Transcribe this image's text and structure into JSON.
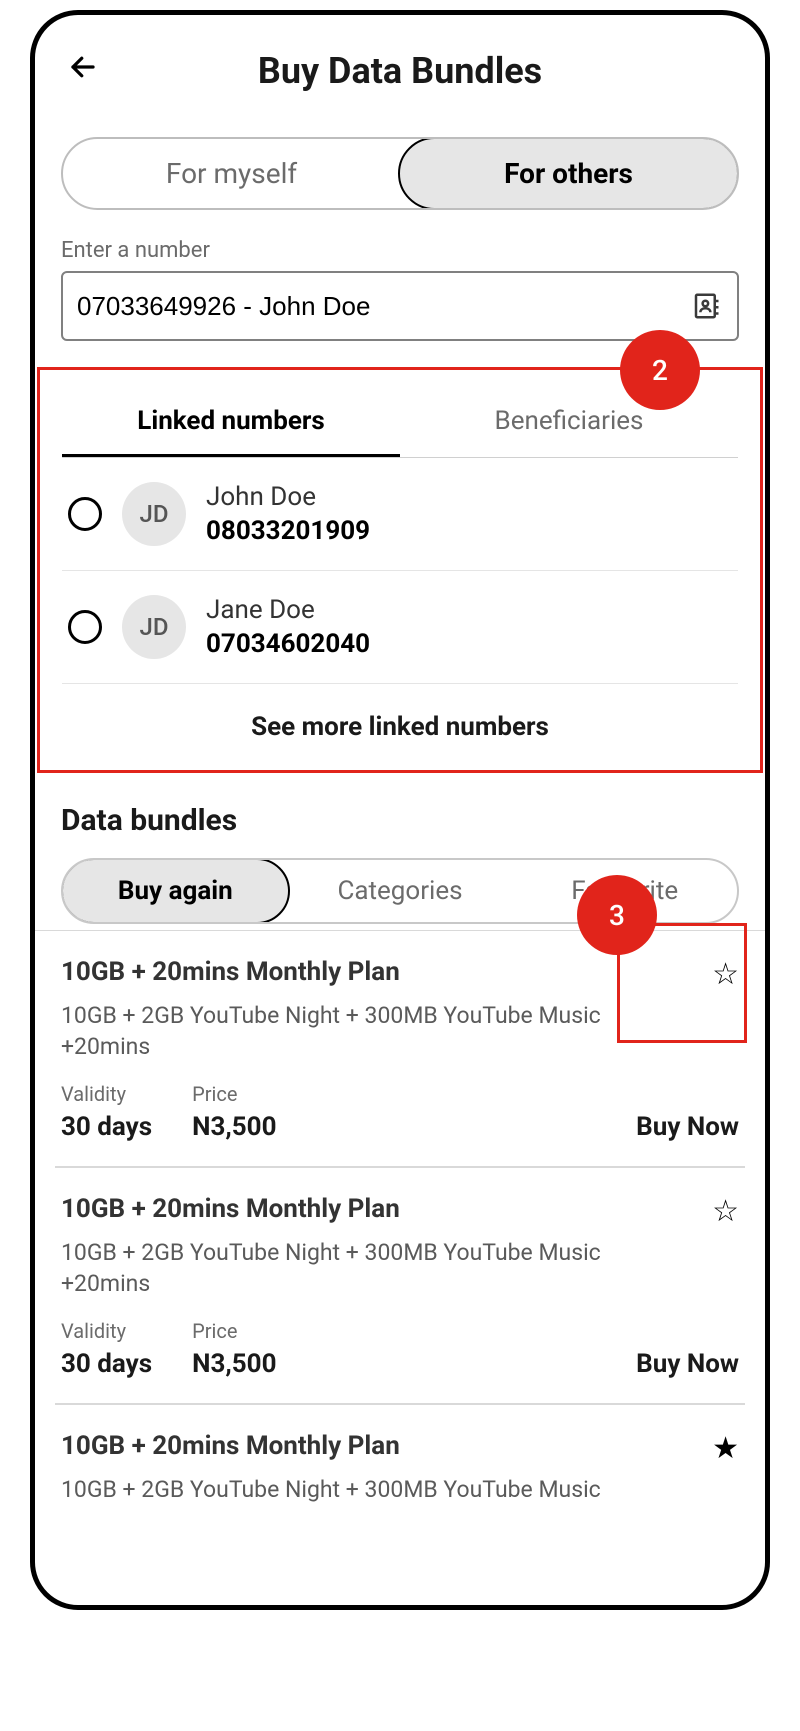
{
  "header": {
    "title": "Buy Data Bundles"
  },
  "segmented": {
    "myself": "For myself",
    "others": "For others",
    "active": "others"
  },
  "number_input": {
    "label": "Enter a number",
    "value": "07033649926 - John Doe"
  },
  "annotation2": {
    "badge": "2"
  },
  "linked_tabs": {
    "linked": "Linked numbers",
    "beneficiaries": "Beneficiaries",
    "active": "linked"
  },
  "contacts": [
    {
      "initials": "JD",
      "name": "John Doe",
      "number": "08033201909"
    },
    {
      "initials": "JD",
      "name": "Jane Doe",
      "number": "07034602040"
    }
  ],
  "see_more": "See more linked numbers",
  "bundles_title": "Data bundles",
  "pill_tabs": {
    "buy_again": "Buy again",
    "categories": "Categories",
    "favourite": "Favourite",
    "active": "buy_again"
  },
  "annotation3": {
    "badge": "3"
  },
  "bundles": [
    {
      "title": "10GB + 20mins Monthly Plan",
      "desc": "10GB + 2GB YouTube Night + 300MB YouTube Music +20mins",
      "validity_label": "Validity",
      "validity": "30 days",
      "price_label": "Price",
      "price": "N3,500",
      "cta": "Buy Now",
      "starred": false
    },
    {
      "title": "10GB + 20mins Monthly Plan",
      "desc": "10GB + 2GB YouTube Night + 300MB YouTube Music +20mins",
      "validity_label": "Validity",
      "validity": "30 days",
      "price_label": "Price",
      "price": "N3,500",
      "cta": "Buy Now",
      "starred": false
    },
    {
      "title": "10GB + 20mins Monthly Plan",
      "desc": "10GB + 2GB YouTube Night + 300MB YouTube Music",
      "starred": true
    }
  ]
}
